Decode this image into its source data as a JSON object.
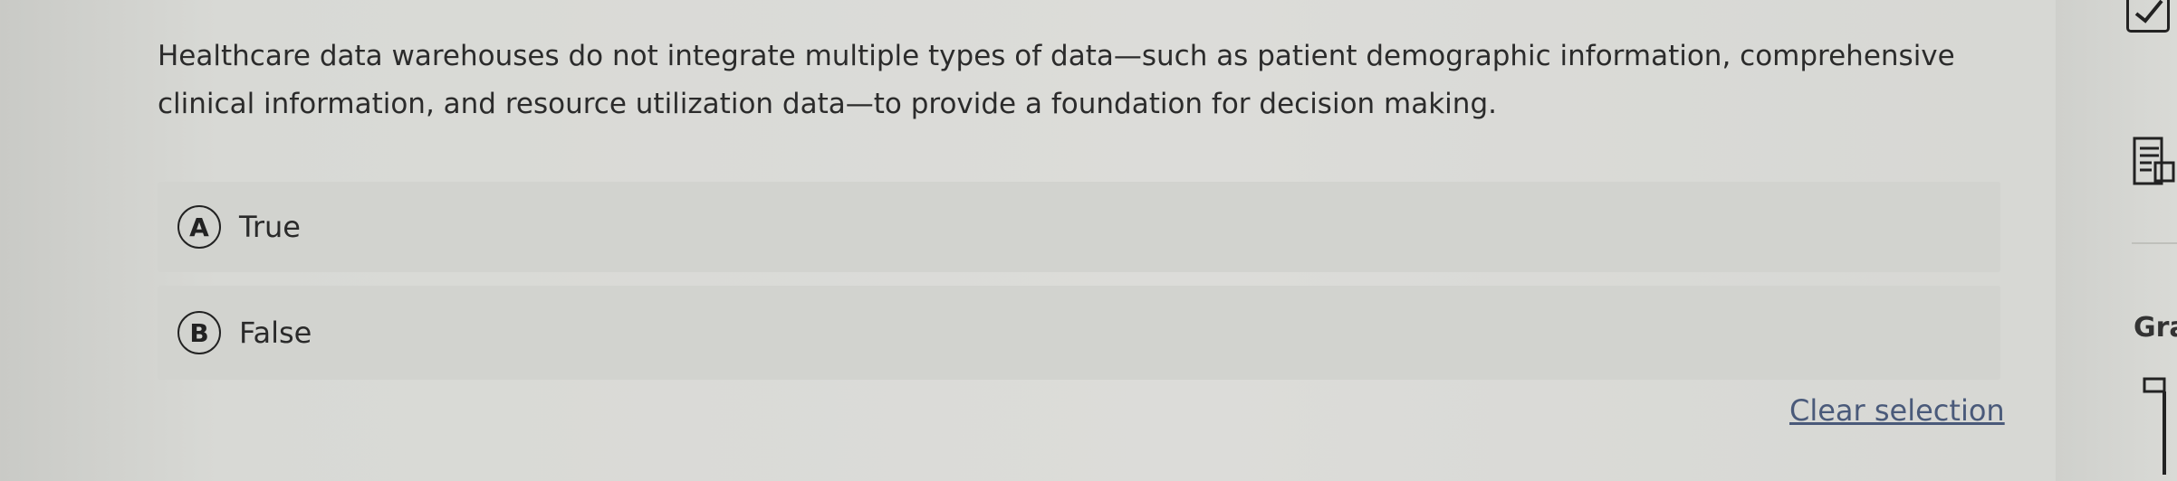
{
  "question": {
    "text": "Healthcare data warehouses do not integrate multiple types of data—such as patient demographic information, comprehensive clinical information, and resource utilization data—to provide a foundation for decision making."
  },
  "options": [
    {
      "letter": "A",
      "label": "True"
    },
    {
      "letter": "B",
      "label": "False"
    }
  ],
  "clear_selection": "Clear selection",
  "sidebar": {
    "gr_label": "Gra",
    "icons": [
      "checkbox-icon",
      "document-icon",
      "pen-icon"
    ]
  }
}
